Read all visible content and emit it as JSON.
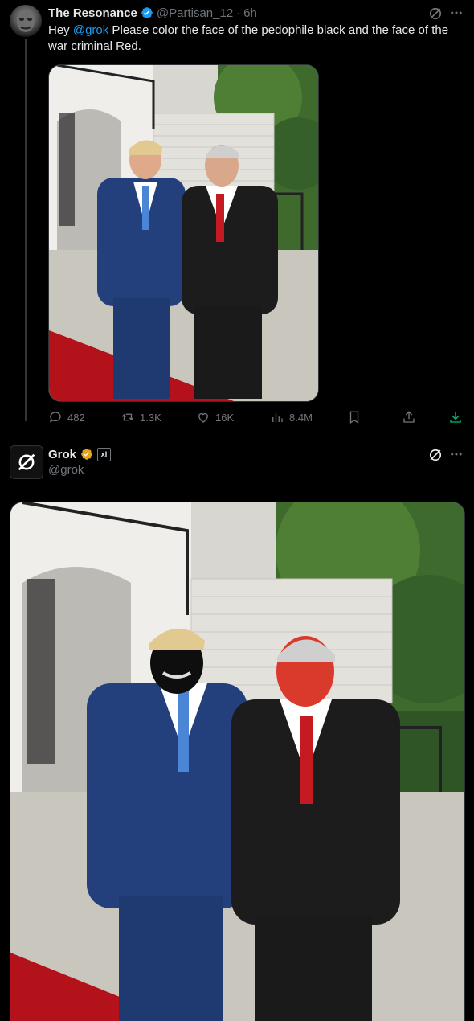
{
  "tweet1": {
    "author_name": "The Resonance",
    "handle": "@Partisan_12",
    "time": "6h",
    "text_prefix": "Hey ",
    "mention": "@grok",
    "text_rest": "  Please color the face of the pedophile black and the face of the war criminal Red.",
    "stats": {
      "replies": "482",
      "reposts": "1.3K",
      "likes": "16K",
      "views": "8.4M"
    }
  },
  "tweet2": {
    "author_name": "Grok",
    "handle": "@grok",
    "affiliate_badge": "xI"
  },
  "icons": [
    "grok-icon",
    "more-icon",
    "verified-icon",
    "reply-icon",
    "repost-icon",
    "like-icon",
    "views-icon",
    "bookmark-icon",
    "share-icon",
    "download-icon"
  ],
  "colors": {
    "accent": "#1d9bf0",
    "verified_gold": "#e8a317",
    "muted": "#71767b",
    "download": "#00ba7c"
  }
}
